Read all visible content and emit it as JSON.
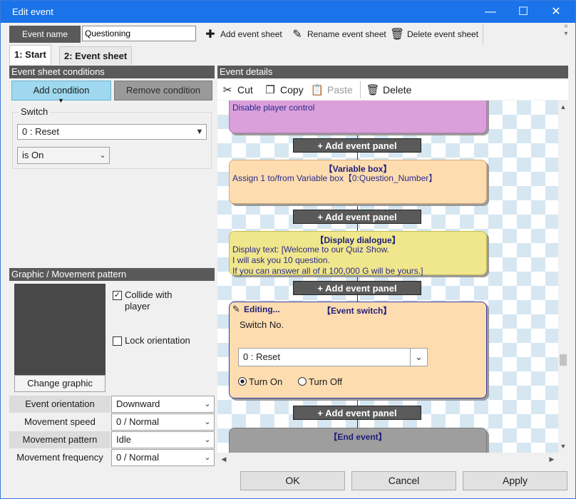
{
  "window": {
    "title": "Edit event",
    "controls": {
      "minimize": "—",
      "maximize": "☐",
      "close": "✕"
    }
  },
  "toolbar": {
    "event_name_label": "Event name",
    "event_name_value": "Questioning",
    "add_sheet": "Add event sheet",
    "rename_sheet": "Rename event sheet",
    "delete_sheet": "Delete event sheet"
  },
  "tabs": [
    {
      "label": "1: Start",
      "active": true
    },
    {
      "label": "2: Event sheet",
      "active": false
    }
  ],
  "conditions": {
    "header": "Event sheet conditions",
    "add": "Add condition",
    "remove": "Remove condition",
    "group_title": "Switch",
    "switch_value": "0 : Reset",
    "state_value": "is On"
  },
  "graphic": {
    "header": "Graphic / Movement pattern",
    "change_graphic": "Change graphic",
    "collide_label": "Collide with player",
    "collide_checked": true,
    "collide_mark": "✓",
    "lock_label": "Lock orientation",
    "lock_checked": false
  },
  "properties": [
    {
      "label": "Event orientation",
      "value": "Downward"
    },
    {
      "label": "Movement speed",
      "value": "0 / Normal"
    },
    {
      "label": "Movement pattern",
      "value": "Idle"
    },
    {
      "label": "Movement frequency",
      "value": "0 / Normal"
    }
  ],
  "details": {
    "header": "Event details",
    "cut": "Cut",
    "copy": "Copy",
    "paste": "Paste",
    "delete": "Delete"
  },
  "flow": {
    "add_panel": "+ Add event panel",
    "panel1_body": "Disable player control",
    "panel2_title": "【Variable box】",
    "panel2_body": "Assign 1 to/from Variable box【0:Question_Number】",
    "panel3_title": "【Display dialogue】",
    "panel3_body": "Display text: [Welcome to our Quiz Show.\nI will ask you 10 question.\nIf you can answer all of it 100,000 G will be yours.]",
    "panel4_editing": "Editing...",
    "panel4_title": "【Event switch】",
    "panel4_switch_label": "Switch No.",
    "panel4_switch_value": "0 : Reset",
    "turn_on": "Turn On",
    "turn_off": "Turn Off",
    "panel5_title": "【End event】"
  },
  "buttons": {
    "ok": "OK",
    "cancel": "Cancel",
    "apply": "Apply"
  },
  "colors": {
    "titlebar": "#1a73e8",
    "panel_purple": "#dba0dc",
    "panel_orange": "#fddcb0",
    "panel_yellow": "#f0e68c",
    "panel_grey": "#9e9e9e",
    "title_navy": "#1f1f7a"
  }
}
